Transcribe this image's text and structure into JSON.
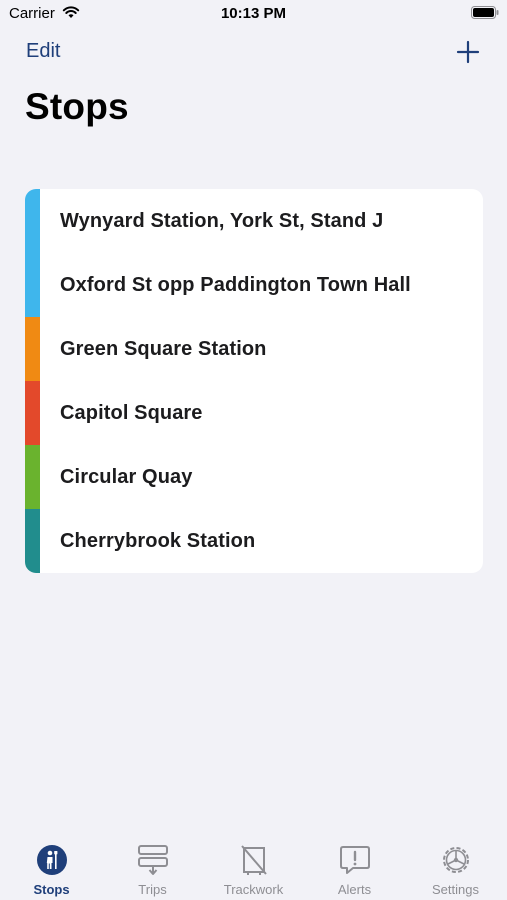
{
  "status_bar": {
    "carrier": "Carrier",
    "time": "10:13 PM"
  },
  "nav": {
    "edit_label": "Edit",
    "title": "Stops"
  },
  "stops": [
    {
      "label": "Wynyard Station, York St, Stand J",
      "color": "#3fb6ec"
    },
    {
      "label": "Oxford St opp Paddington Town Hall",
      "color": "#3fb6ec"
    },
    {
      "label": "Green Square Station",
      "color": "#f08a13"
    },
    {
      "label": "Capitol Square",
      "color": "#e3492b"
    },
    {
      "label": "Circular Quay",
      "color": "#6ab32e"
    },
    {
      "label": "Cherrybrook Station",
      "color": "#218d8d"
    }
  ],
  "tabs": [
    {
      "label": "Stops",
      "icon": "person-stop-icon",
      "active": true
    },
    {
      "label": "Trips",
      "icon": "trips-icon",
      "active": false
    },
    {
      "label": "Trackwork",
      "icon": "trackwork-icon",
      "active": false
    },
    {
      "label": "Alerts",
      "icon": "alert-bubble-icon",
      "active": false
    },
    {
      "label": "Settings",
      "icon": "gear-icon",
      "active": false
    }
  ],
  "colors": {
    "accent": "#1f3f7a",
    "inactive": "#8e8e93",
    "background": "#f2f2f7"
  }
}
